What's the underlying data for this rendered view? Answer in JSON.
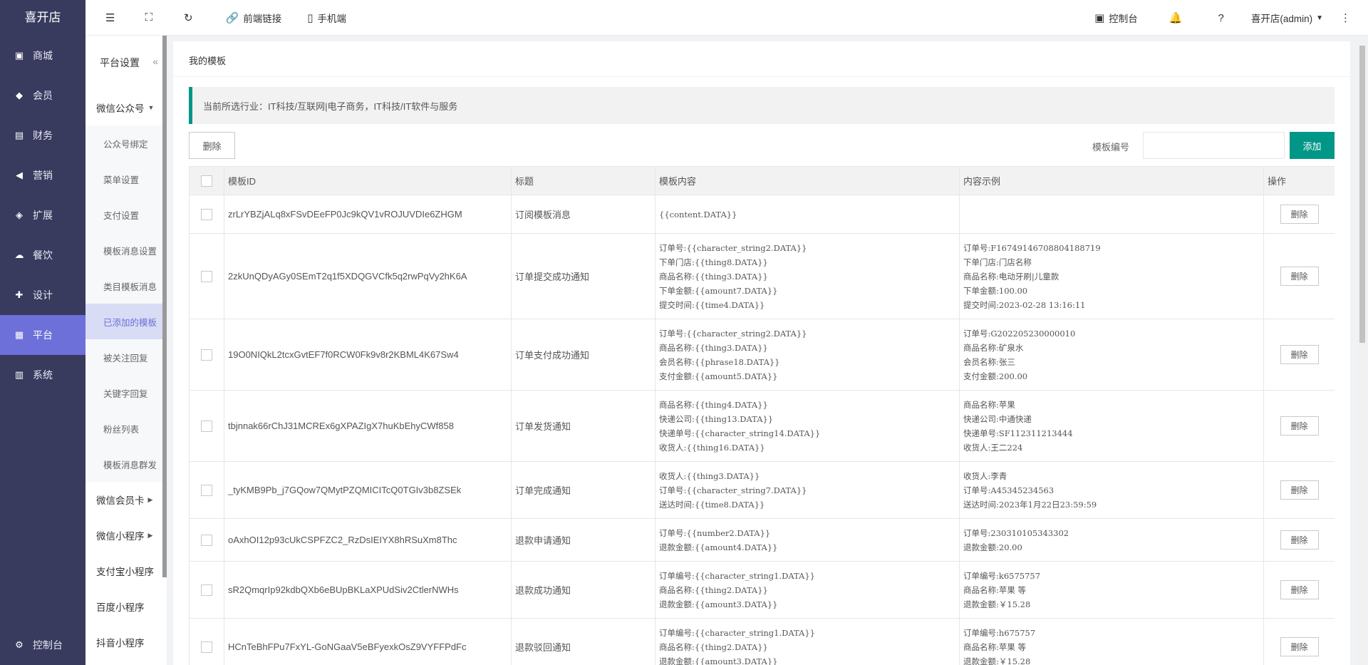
{
  "app": {
    "logo": "喜开店"
  },
  "mainnav": {
    "items": [
      {
        "label": "商城",
        "icon": "mall-icon"
      },
      {
        "label": "会员",
        "icon": "member-icon"
      },
      {
        "label": "财务",
        "icon": "finance-icon"
      },
      {
        "label": "营销",
        "icon": "megaphone-icon"
      },
      {
        "label": "扩展",
        "icon": "cube-icon"
      },
      {
        "label": "餐饮",
        "icon": "cloud-icon"
      },
      {
        "label": "设计",
        "icon": "puzzle-icon"
      },
      {
        "label": "平台",
        "icon": "grid-icon"
      },
      {
        "label": "系统",
        "icon": "monitor-icon"
      }
    ],
    "active": "平台",
    "bottom": {
      "label": "控制台",
      "icon": "gear-icon"
    }
  },
  "subnav": {
    "title": "平台设置",
    "collapse": "«",
    "groups": [
      {
        "label": "微信公众号",
        "arrow": "▼"
      },
      {
        "label": "微信会员卡",
        "arrow": "▶"
      },
      {
        "label": "微信小程序",
        "arrow": "▶"
      },
      {
        "label": "支付宝小程序"
      },
      {
        "label": "百度小程序"
      },
      {
        "label": "抖音小程序"
      }
    ],
    "items": [
      "公众号绑定",
      "菜单设置",
      "支付设置",
      "模板消息设置",
      "类目模板消息",
      "已添加的模板",
      "被关注回复",
      "关键字回复",
      "粉丝列表",
      "模板消息群发"
    ],
    "active": "已添加的模板"
  },
  "topbar": {
    "links": [
      {
        "label": "前端链接"
      },
      {
        "label": "手机端"
      }
    ],
    "console": "控制台",
    "user": "喜开店(admin)"
  },
  "page": {
    "title": "我的模板",
    "tip": "当前所选行业：IT科技/互联网|电子商务，IT科技/IT软件与服务",
    "delete_label": "删除",
    "code_label": "模板编号",
    "code_value": "",
    "add_label": "添加"
  },
  "table": {
    "headers": [
      "模板ID",
      "标题",
      "模板内容",
      "内容示例",
      "操作"
    ],
    "op_label": "删除",
    "rows": [
      {
        "id": "zrLrYBZjALq8xFSvDEeFP0Jc9kQV1vROJUVDIe6ZHGM",
        "title": "订阅模板消息",
        "content": "{{content.DATA}}",
        "example": ""
      },
      {
        "id": "2zkUnQDyAGy0SEmT2q1f5XDQGVCfk5q2rwPqVy2hK6A",
        "title": "订单提交成功通知",
        "content": "订单号:{{character_string2.DATA}}\n下单门店:{{thing8.DATA}}\n商品名称:{{thing3.DATA}}\n下单金额:{{amount7.DATA}}\n提交时间:{{time4.DATA}}",
        "example": "订单号:F16749146708804188719\n下单门店:门店名称\n商品名称:电动牙刷|儿童款\n下单金额:100.00\n提交时间:2023-02-28 13:16:11"
      },
      {
        "id": "19O0NIQkL2tcxGvtEF7f0RCW0Fk9v8r2KBML4K67Sw4",
        "title": "订单支付成功通知",
        "content": "订单号:{{character_string2.DATA}}\n商品名称:{{thing3.DATA}}\n会员名称:{{phrase18.DATA}}\n支付金额:{{amount5.DATA}}",
        "example": "订单号:G202205230000010\n商品名称:矿泉水\n会员名称:张三\n支付金额:200.00"
      },
      {
        "id": "tbjnnak66rChJ31MCREx6gXPAZIgX7huKbEhyCWf858",
        "title": "订单发货通知",
        "content": "商品名称:{{thing4.DATA}}\n快递公司:{{thing13.DATA}}\n快递单号:{{character_string14.DATA}}\n收货人:{{thing16.DATA}}",
        "example": "商品名称:苹果\n快递公司:中通快递\n快递单号:SF112311213444\n收货人:王二224"
      },
      {
        "id": "_tyKMB9Pb_j7GQow7QMytPZQMICITcQ0TGIv3b8ZSEk",
        "title": "订单完成通知",
        "content": "收货人:{{thing3.DATA}}\n订单号:{{character_string7.DATA}}\n送达时间:{{time8.DATA}}",
        "example": "收货人:李青\n订单号:A45345234563\n送达时间:2023年1月22日23:59:59"
      },
      {
        "id": "oAxhOI12p93cUkCSPFZC2_RzDsIEIYX8hRSuXm8Thc",
        "title": "退款申请通知",
        "content": "订单号:{{number2.DATA}}\n退款金额:{{amount4.DATA}}",
        "example": "订单号:230310105343302\n退款金额:20.00"
      },
      {
        "id": "sR2QmqrIp92kdbQXb6eBUpBKLaXPUdSiv2CtlerNWHs",
        "title": "退款成功通知",
        "content": "订单编号:{{character_string1.DATA}}\n商品名称:{{thing2.DATA}}\n退款金额:{{amount3.DATA}}",
        "example": "订单编号:k6575757\n商品名称:苹果 等\n退款金额:￥15.28"
      },
      {
        "id": "HCnTeBhFPu7FxYL-GoNGaaV5eBFyexkOsZ9VYFFPdFc",
        "title": "退款驳回通知",
        "content": "订单编号:{{character_string1.DATA}}\n商品名称:{{thing2.DATA}}\n退款金额:{{amount3.DATA}}",
        "example": "订单编号:h675757\n商品名称:苹果 等\n退款金额:￥15.28"
      }
    ]
  }
}
